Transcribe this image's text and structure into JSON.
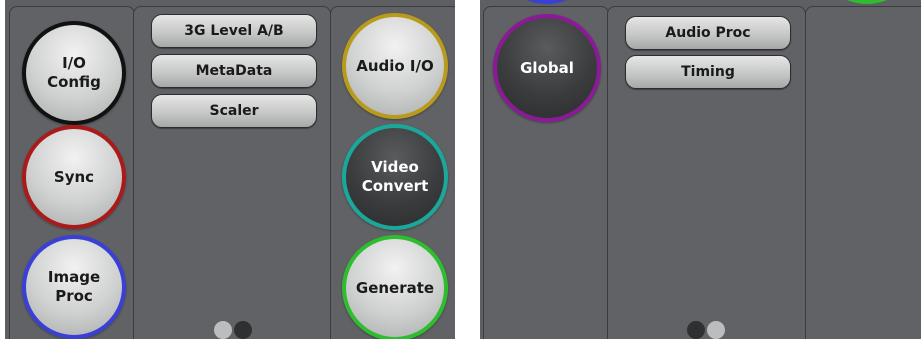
{
  "screens": [
    {
      "left_column": [
        {
          "label": "I/O\nConfig",
          "ring": "#111111",
          "style": "light"
        },
        {
          "label": "Sync",
          "ring": "#aa1a1a",
          "style": "light"
        },
        {
          "label": "Image\nProc",
          "ring": "#3a3fd6",
          "style": "light"
        }
      ],
      "middle_buttons": [
        "3G Level A/B",
        "MetaData",
        "Scaler"
      ],
      "right_column": [
        {
          "label": "Audio I/O",
          "ring": "#b89a1c",
          "style": "light"
        },
        {
          "label": "Video\nConvert",
          "ring": "#1aa89a",
          "style": "dark"
        },
        {
          "label": "Generate",
          "ring": "#2ebd2e",
          "style": "light"
        }
      ],
      "page_indicator": {
        "pages": 2,
        "current": 2
      }
    },
    {
      "left_column": [
        {
          "label": "Global",
          "ring": "#8a1a96",
          "style": "dark"
        }
      ],
      "middle_buttons": [
        "Audio Proc",
        "Timing"
      ],
      "right_column": [],
      "page_indicator": {
        "pages": 2,
        "current": 1
      },
      "offscreen_hints": {
        "top_left_ring": "#3a3fd6",
        "top_right_ring": "#2ebd2e"
      }
    }
  ]
}
